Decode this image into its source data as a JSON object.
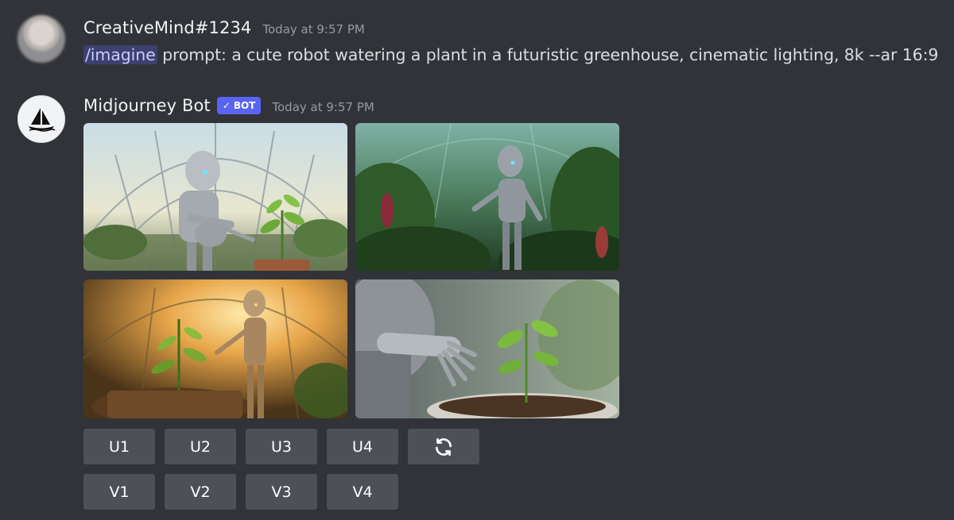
{
  "messages": {
    "user": {
      "username": "CreativeMind#1234",
      "timestamp": "Today at 9:57 PM",
      "command": "/imagine",
      "text": " prompt: a cute robot watering a plant in a futuristic greenhouse, cinematic lighting, 8k --ar 16:9"
    },
    "bot": {
      "username": "Midjourney Bot",
      "badge": "BOT",
      "badge_check": "✓",
      "timestamp": "Today at 9:57 PM",
      "images": [
        {
          "subject": "robot watering plant with watering can in glass dome greenhouse"
        },
        {
          "subject": "robot in dense green jungle greenhouse"
        },
        {
          "subject": "robot tending plant in golden sunlight greenhouse"
        },
        {
          "subject": "robot hand reaching toward sprouting plant close-up"
        }
      ],
      "upscale_buttons": [
        "U1",
        "U2",
        "U3",
        "U4"
      ],
      "reroll_icon": "refresh-icon",
      "variation_buttons": [
        "V1",
        "V2",
        "V3",
        "V4"
      ]
    }
  },
  "colors": {
    "background": "#313338",
    "button": "#4e5058",
    "bot_badge": "#5865f2",
    "mention_bg": "rgba(88,101,242,0.3)"
  }
}
